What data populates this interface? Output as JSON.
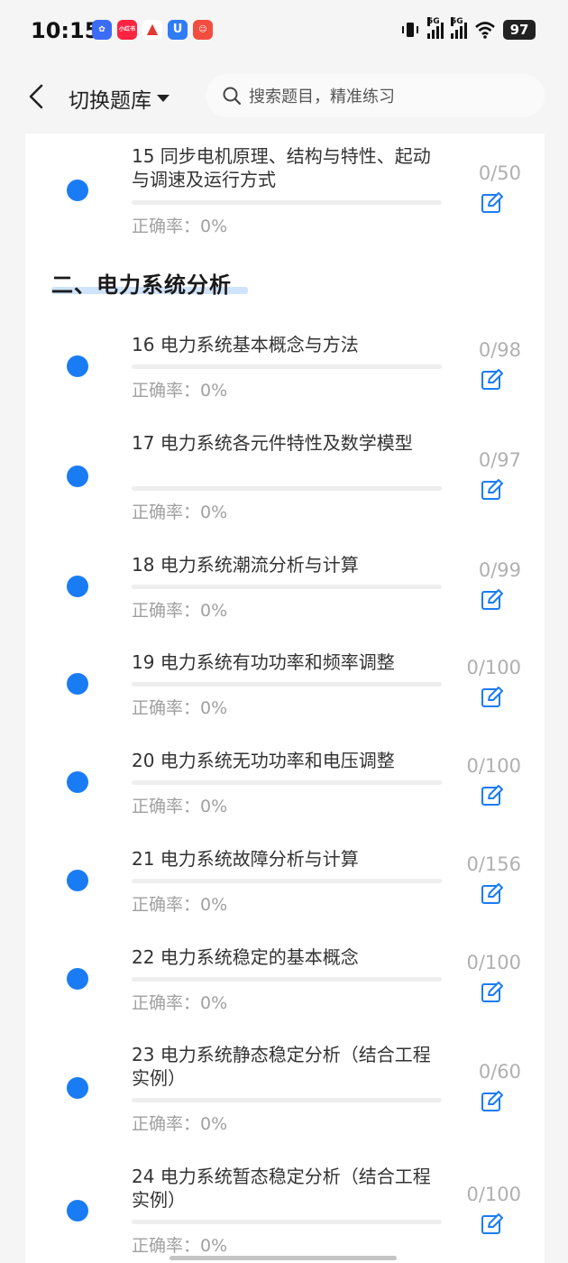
{
  "status": {
    "time": "10:15",
    "battery": "97",
    "apps": [
      {
        "icon": "app-icon-blue",
        "color": "#3b6cf6",
        "label": ""
      },
      {
        "icon": "app-icon-xiaohongshu",
        "color": "#ff2442",
        "label": "小红书"
      },
      {
        "icon": "app-icon-red-triangle",
        "color": "#ffffff",
        "label": ""
      },
      {
        "icon": "app-icon-blue-u",
        "color": "#2f7cf6",
        "label": "U"
      },
      {
        "icon": "app-icon-red-game",
        "color": "#f24d3e",
        "label": ""
      }
    ],
    "network": [
      "5G",
      "5G"
    ]
  },
  "navbar": {
    "title": "切换题库",
    "search_placeholder": "搜索题目，精准练习"
  },
  "section": {
    "title": "二、电力系统分析"
  },
  "top_item": {
    "name": "15 同步电机原理、结构与特性、起动与调速及运行方式",
    "accuracy": "正确率：0%",
    "count": "0/50"
  },
  "items": [
    {
      "name": "16 电力系统基本概念与方法",
      "accuracy": "正确率：0%",
      "count": "0/98"
    },
    {
      "name": "17 电力系统各元件特性及数学模型",
      "accuracy": "正确率：0%",
      "count": "0/97"
    },
    {
      "name": "18 电力系统潮流分析与计算",
      "accuracy": "正确率：0%",
      "count": "0/99"
    },
    {
      "name": "19 电力系统有功功率和频率调整",
      "accuracy": "正确率：0%",
      "count": "0/100"
    },
    {
      "name": "20 电力系统无功功率和电压调整",
      "accuracy": "正确率：0%",
      "count": "0/100"
    },
    {
      "name": "21 电力系统故障分析与计算",
      "accuracy": "正确率：0%",
      "count": "0/156"
    },
    {
      "name": "22 电力系统稳定的基本概念",
      "accuracy": "正确率：0%",
      "count": "0/100"
    },
    {
      "name": "23 电力系统静态稳定分析（结合工程实例）",
      "accuracy": "正确率：0%",
      "count": "0/60"
    },
    {
      "name": "24 电力系统暂态稳定分析（结合工程实例）",
      "accuracy": "正确率：0%",
      "count": "0/100"
    }
  ],
  "colors": {
    "accent": "#1a7cf5",
    "muted": "#a0a0a0",
    "section_highlight": "#cfe3fb"
  }
}
